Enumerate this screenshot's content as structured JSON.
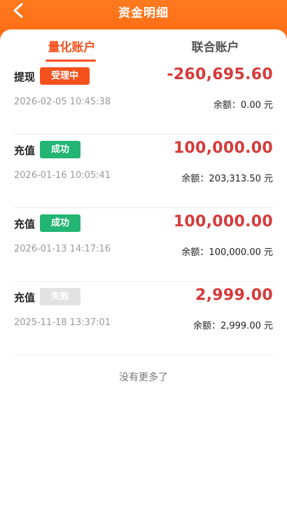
{
  "header": {
    "title": "资金明细"
  },
  "tabs": [
    {
      "label": "量化账户",
      "active": true
    },
    {
      "label": "联合账户",
      "active": false
    }
  ],
  "colors": {
    "header_bg": "#ff6a12",
    "accent": "#f4511e",
    "amount": "#d63a3a",
    "badge_processing": "#f4511e",
    "badge_success": "#22b573",
    "badge_failed": "#e2e2e2"
  },
  "records": [
    {
      "type": "提现",
      "status": "受理中",
      "status_kind": "processing",
      "date": "2026-02-05 10:45:38",
      "amount": "-260,695.60",
      "balance": "余额：0.00 元"
    },
    {
      "type": "充值",
      "status": "成功",
      "status_kind": "success",
      "date": "2026-01-16 10:05:41",
      "amount": "100,000.00",
      "balance": "余额：203,313.50 元"
    },
    {
      "type": "充值",
      "status": "成功",
      "status_kind": "success",
      "date": "2026-01-13 14:17:16",
      "amount": "100,000.00",
      "balance": "余额：100,000.00 元"
    },
    {
      "type": "充值",
      "status": "失败",
      "status_kind": "failed",
      "date": "2025-11-18 13:37:01",
      "amount": "2,999.00",
      "balance": "余额：2,999.00 元"
    }
  ],
  "footer": {
    "no_more_text": "没有更多了"
  }
}
